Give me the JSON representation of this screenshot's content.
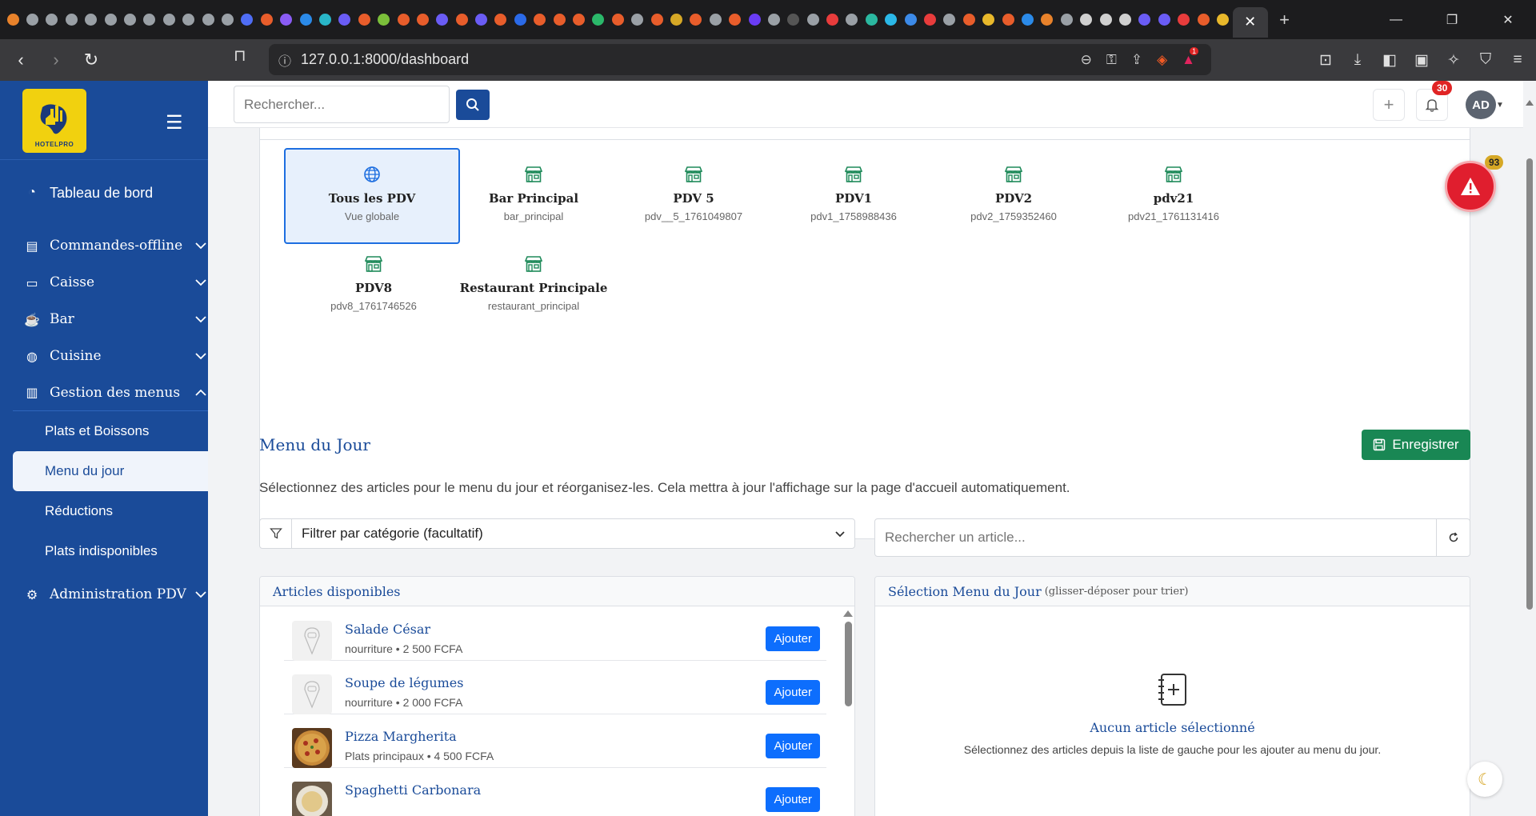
{
  "browser": {
    "url": "127.0.0.1:8000/dashboard",
    "tab_icon_colors": [
      "#e8822b",
      "#9aa0a6",
      "#9aa0a6",
      "#9aa0a6",
      "#9aa0a6",
      "#9aa0a6",
      "#9aa0a6",
      "#9aa0a6",
      "#9aa0a6",
      "#9aa0a6",
      "#9aa0a6",
      "#9aa0a6",
      "#4f6df5",
      "#e85d2b",
      "#8a5cf5",
      "#2b8ae8",
      "#29b6c8",
      "#6a5cf5",
      "#e85d2b",
      "#7bbf3a",
      "#e85d2b",
      "#e85d2b",
      "#6a5cf5",
      "#e85d2b",
      "#6a5cf5",
      "#e85d2b",
      "#2b6ae8",
      "#e85d2b",
      "#e85d2b",
      "#e85d2b",
      "#2bb86a",
      "#e85d2b",
      "#9aa0a6",
      "#e85d2b",
      "#d6a826",
      "#e85d2b",
      "#9aa0a6",
      "#e85d2b",
      "#6a3cf5",
      "#9aa0a6",
      "#555555",
      "#9aa0a6",
      "#e83c3c",
      "#9aa0a6",
      "#2bb8a0",
      "#2bb8e8",
      "#3c8ae8",
      "#e83c3c",
      "#9aa0a6",
      "#e85d2b",
      "#e8b82b",
      "#e85d2b",
      "#2b8ae8",
      "#e8822b",
      "#9aa0a6",
      "#d0d0d0",
      "#d0d0d0",
      "#d0d0d0",
      "#6a5cf5",
      "#6a5cf5",
      "#e83c3c",
      "#e85d2b",
      "#e8b82b"
    ],
    "alert_badge": "1"
  },
  "sidebar": {
    "logo_text": "HOTELPRO",
    "items": [
      {
        "label": "Tableau de bord",
        "icon": "gauge-icon"
      },
      {
        "label": "Commandes-offline",
        "icon": "list-icon"
      },
      {
        "label": "Caisse",
        "icon": "cash-icon"
      },
      {
        "label": "Bar",
        "icon": "cup-icon"
      },
      {
        "label": "Cuisine",
        "icon": "cooking-icon"
      },
      {
        "label": "Gestion des menus",
        "icon": "menu-book-icon"
      },
      {
        "label": "Administration PDV",
        "icon": "gear-icon"
      }
    ],
    "subitems": [
      "Plats et Boissons",
      "Menu du jour",
      "Réductions",
      "Plats indisponibles"
    ],
    "active_subitem": "Menu du jour"
  },
  "header": {
    "search_placeholder": "Rechercher...",
    "notification_count": "30",
    "avatar_initials": "AD"
  },
  "pdv_section": {
    "tiles": [
      {
        "name": "Tous les PDV",
        "code": "Vue globale",
        "icon": "globe-icon",
        "active": true
      },
      {
        "name": "Bar Principal",
        "code": "bar_principal",
        "icon": "store-icon"
      },
      {
        "name": "PDV 5",
        "code": "pdv__5_1761049807",
        "icon": "store-icon"
      },
      {
        "name": "PDV1",
        "code": "pdv1_1758988436",
        "icon": "store-icon"
      },
      {
        "name": "PDV2",
        "code": "pdv2_1759352460",
        "icon": "store-icon"
      },
      {
        "name": "pdv21",
        "code": "pdv21_1761131416",
        "icon": "store-icon"
      },
      {
        "name": "PDV8",
        "code": "pdv8_1761746526",
        "icon": "store-icon"
      },
      {
        "name": "Restaurant Principale",
        "code": "restaurant_principal",
        "icon": "store-icon"
      }
    ]
  },
  "menu_du_jour": {
    "title": "Menu du Jour",
    "save_label": "Enregistrer",
    "description": "Sélectionnez des articles pour le menu du jour et réorganisez-les. Cela mettra à jour l'affichage sur la page d'accueil automatiquement.",
    "filter_label": "Filtrer par catégorie (facultatif)",
    "article_search_placeholder": "Rechercher un article...",
    "available_title": "Articles disponibles",
    "selection_title": "Sélection Menu du Jour",
    "selection_hint": "(glisser-déposer pour trier)",
    "empty_title": "Aucun article sélectionné",
    "empty_desc": "Sélectionnez des articles depuis la liste de gauche pour les ajouter au menu du jour.",
    "add_label": "Ajouter",
    "articles": [
      {
        "name": "Salade César",
        "meta": "nourriture • 2 500 FCFA",
        "thumb": "placeholder"
      },
      {
        "name": "Soupe de légumes",
        "meta": "nourriture • 2 000 FCFA",
        "thumb": "placeholder"
      },
      {
        "name": "Pizza Margherita",
        "meta": "Plats principaux • 4 500 FCFA",
        "thumb": "pizza"
      },
      {
        "name": "Spaghetti Carbonara",
        "meta": "",
        "thumb": "pasta"
      }
    ]
  },
  "alerts": {
    "count": "93"
  },
  "colors": {
    "sidebar": "#1a4b99",
    "primary": "#0d6efd",
    "success": "#198754",
    "danger": "#e01e2e",
    "pdv_icon": "#1f8a5a"
  }
}
